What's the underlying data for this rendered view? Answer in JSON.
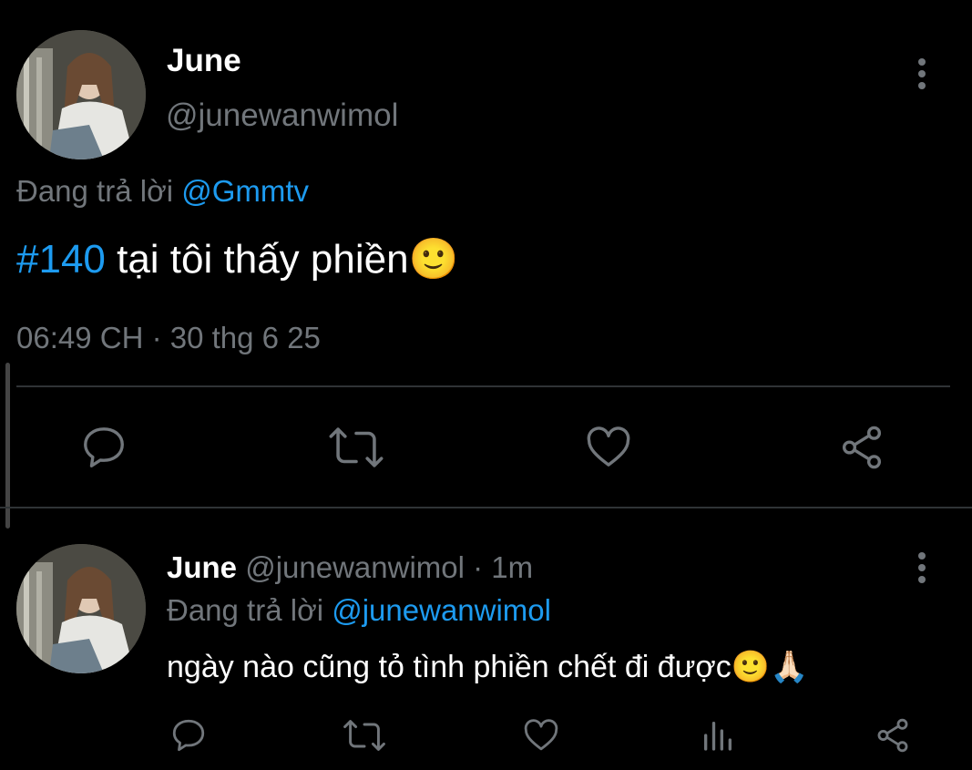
{
  "main_tweet": {
    "name": "June",
    "handle": "@junewanwimol",
    "replying_prefix": "Đang trả lời",
    "replying_to": "@Gmmtv",
    "hashtag": "#140",
    "text": " tại tôi thấy phiền🙂",
    "time": "06:49 CH",
    "sep": " · ",
    "date": "30 thg 6 25"
  },
  "reply_tweet": {
    "name": "June",
    "handle": "@junewanwimol",
    "meta_sep": " · ",
    "age": "1m",
    "replying_prefix": "Đang trả lời",
    "replying_to": "@junewanwimol",
    "text": "ngày nào cũng tỏ tình phiền chết đi được🙂🙏🏻"
  },
  "icons": {
    "reply": "reply-icon",
    "retweet": "retweet-icon",
    "like": "heart-icon",
    "share": "share-icon",
    "analytics": "analytics-icon",
    "more": "more-vertical-icon"
  },
  "colors": {
    "background": "#000000",
    "text": "#e7e9ea",
    "muted": "#71767b",
    "link": "#1d9bf0",
    "divider": "#2f3336"
  }
}
